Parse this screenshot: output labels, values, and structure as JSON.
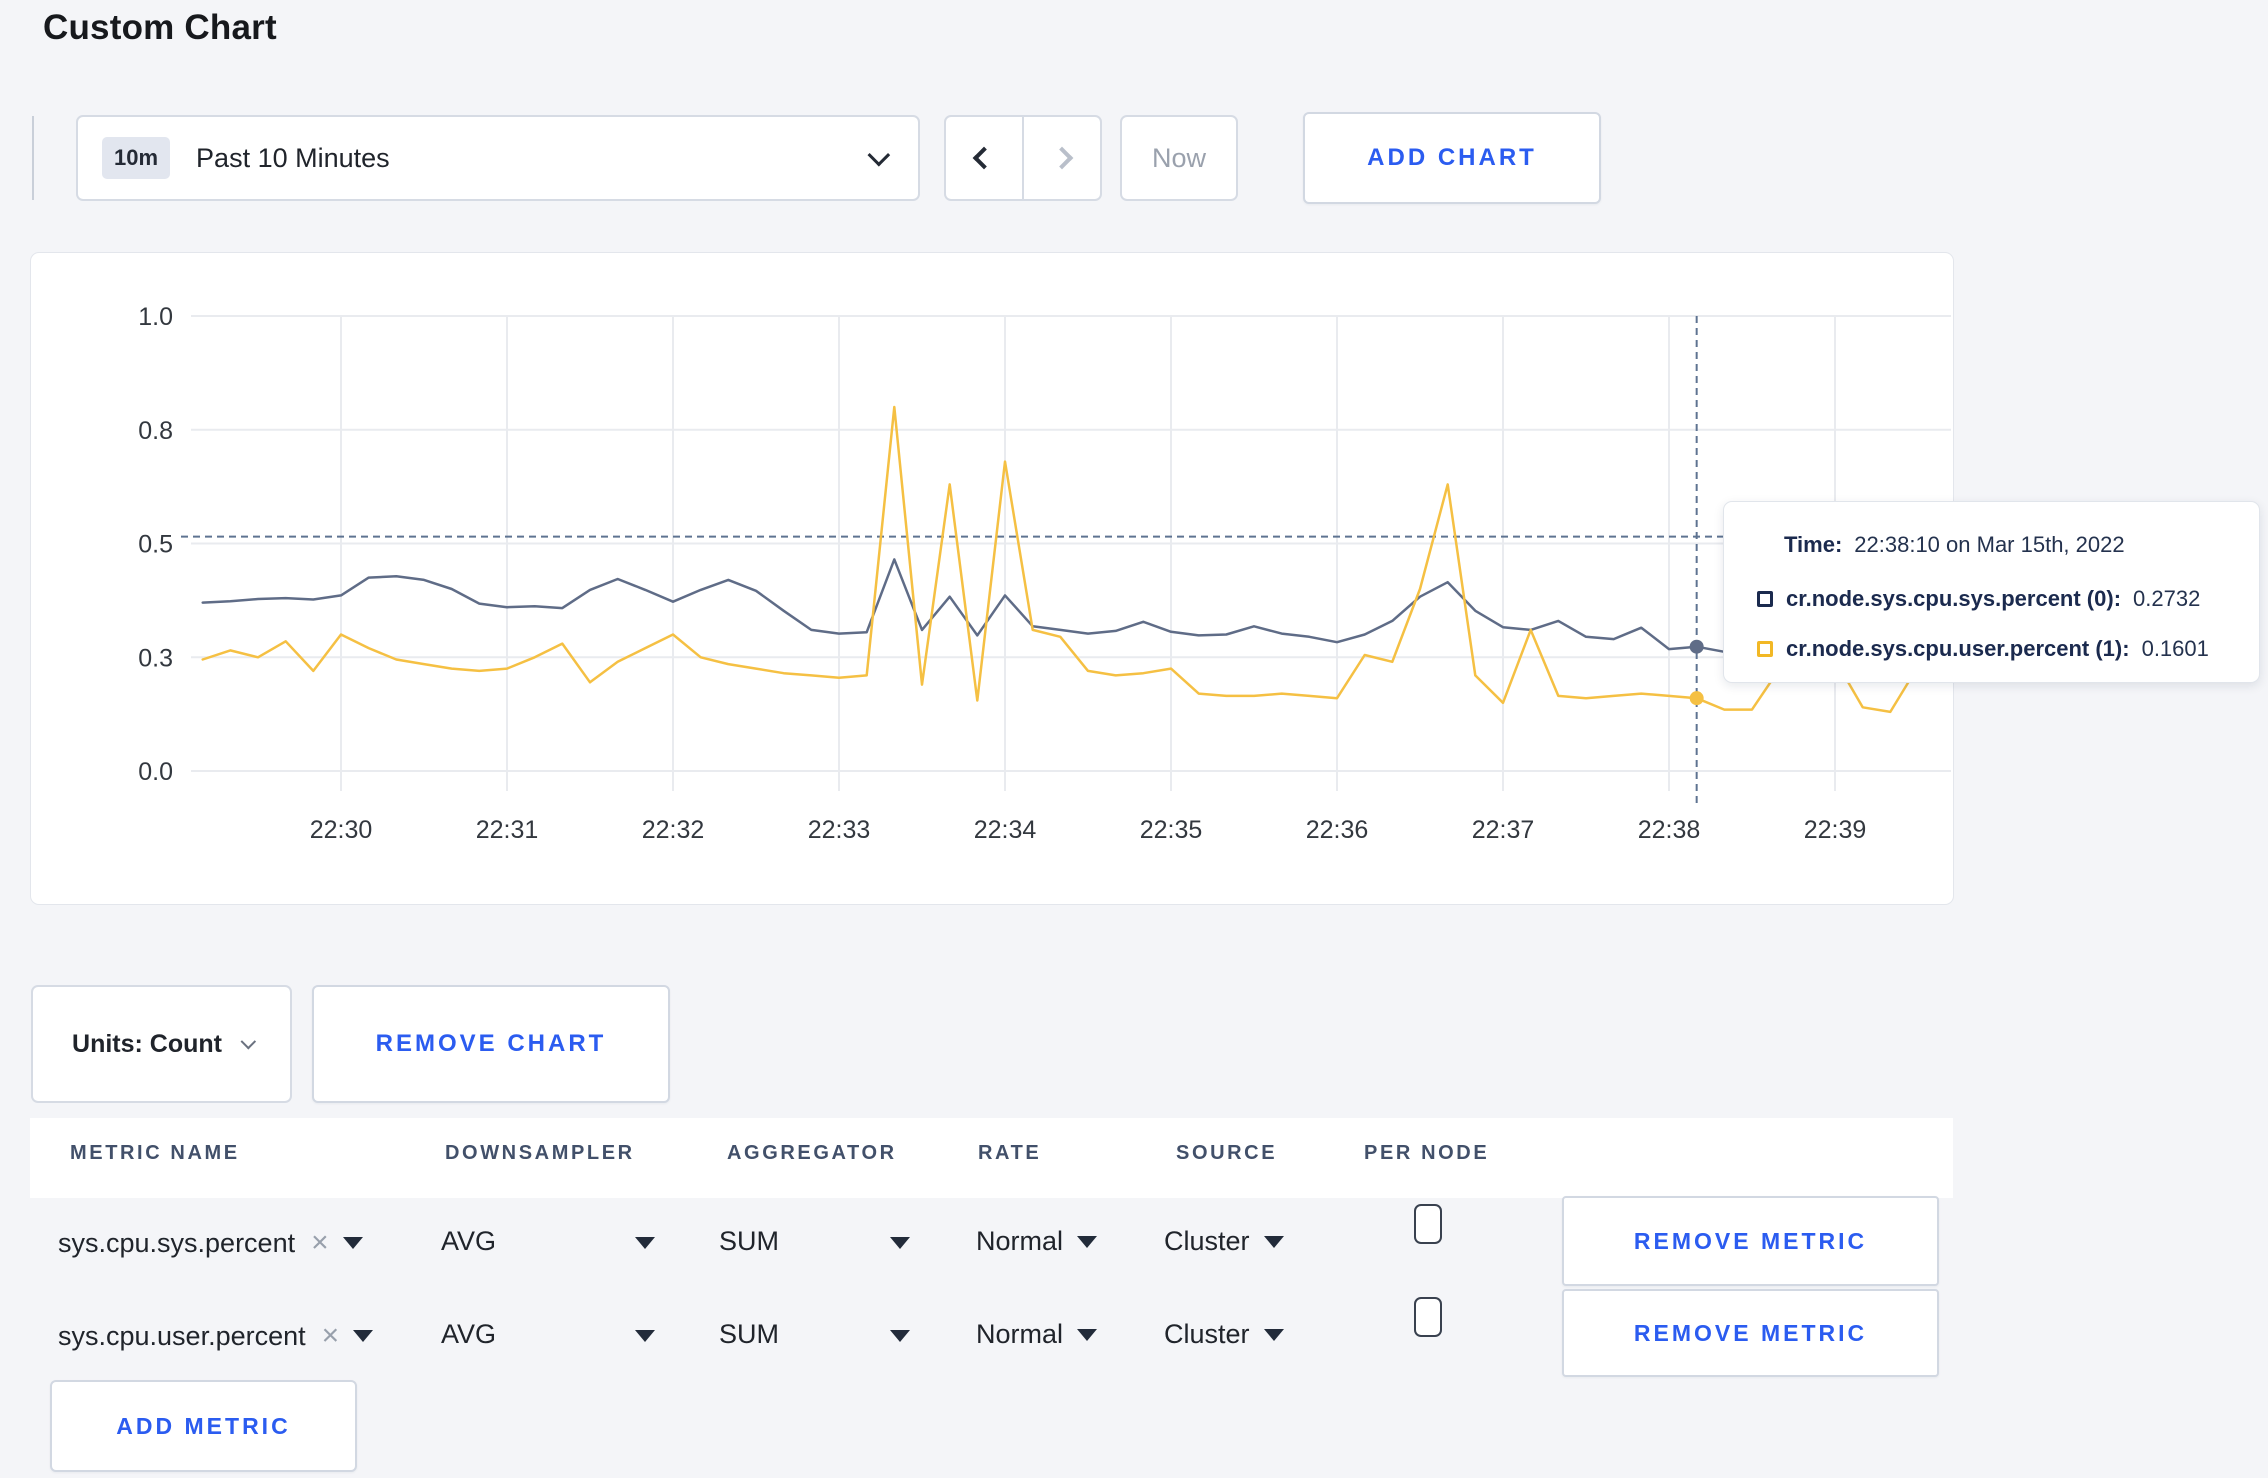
{
  "page": {
    "title": "Custom Chart"
  },
  "toolbar": {
    "range_badge": "10m",
    "range_label": "Past 10 Minutes",
    "now_label": "Now",
    "add_chart_label": "ADD CHART"
  },
  "chart_data": {
    "type": "line",
    "title": "",
    "x_start": "22:29:10",
    "x_interval_seconds": 10,
    "x_tick_labels": [
      "22:30",
      "22:31",
      "22:32",
      "22:33",
      "22:34",
      "22:35",
      "22:36",
      "22:37",
      "22:38",
      "22:39"
    ],
    "y_tick_labels": [
      "1.0",
      "0.8",
      "0.5",
      "0.3",
      "0.0"
    ],
    "ylim": [
      0,
      1
    ],
    "grid": true,
    "series": [
      {
        "name": "cr.node.sys.cpu.sys.percent",
        "color": "#5f6c87",
        "values": [
          0.37,
          0.373,
          0.378,
          0.38,
          0.377,
          0.386,
          0.425,
          0.428,
          0.42,
          0.4,
          0.368,
          0.36,
          0.362,
          0.358,
          0.398,
          0.422,
          0.398,
          0.372,
          0.398,
          0.42,
          0.396,
          0.352,
          0.31,
          0.302,
          0.305,
          0.465,
          0.31,
          0.383,
          0.298,
          0.386,
          0.318,
          0.31,
          0.302,
          0.308,
          0.328,
          0.306,
          0.298,
          0.3,
          0.318,
          0.302,
          0.295,
          0.283,
          0.3,
          0.33,
          0.383,
          0.415,
          0.352,
          0.316,
          0.31,
          0.33,
          0.295,
          0.29,
          0.315,
          0.268,
          0.2732,
          0.262,
          0.27,
          0.285,
          0.29,
          0.285,
          0.29,
          0.295,
          0.3,
          0.3
        ]
      },
      {
        "name": "cr.node.sys.cpu.user.percent",
        "color": "#f5c043",
        "values": [
          0.245,
          0.265,
          0.25,
          0.285,
          0.22,
          0.3,
          0.27,
          0.245,
          0.235,
          0.225,
          0.22,
          0.225,
          0.25,
          0.28,
          0.195,
          0.24,
          0.27,
          0.3,
          0.25,
          0.235,
          0.225,
          0.215,
          0.21,
          0.205,
          0.21,
          0.8,
          0.19,
          0.63,
          0.155,
          0.68,
          0.31,
          0.295,
          0.22,
          0.21,
          0.215,
          0.225,
          0.17,
          0.165,
          0.165,
          0.17,
          0.165,
          0.16,
          0.255,
          0.24,
          0.4,
          0.63,
          0.21,
          0.15,
          0.31,
          0.165,
          0.16,
          0.165,
          0.17,
          0.165,
          0.1601,
          0.135,
          0.135,
          0.225,
          0.23,
          0.245,
          0.14,
          0.13,
          0.23,
          0.27
        ]
      }
    ],
    "crosshair": {
      "x_index": 54,
      "time": "22:38:10",
      "y_value": 0.515
    }
  },
  "tooltip": {
    "time_label": "Time:",
    "time_value": "22:38:10 on Mar 15th, 2022",
    "rows": [
      {
        "name": "cr.node.sys.cpu.sys.percent (0):",
        "value": "0.2732",
        "color": "#1b2a4e"
      },
      {
        "name": "cr.node.sys.cpu.user.percent (1):",
        "value": "0.1601",
        "color": "#f2b825"
      }
    ]
  },
  "chart_footer": {
    "units_label": "Units: Count",
    "remove_chart_label": "REMOVE CHART"
  },
  "metrics_table": {
    "headers": [
      "METRIC NAME",
      "DOWNSAMPLER",
      "AGGREGATOR",
      "RATE",
      "SOURCE",
      "PER NODE"
    ],
    "rows": [
      {
        "metric": "sys.cpu.sys.percent",
        "remove_icon": "×",
        "downsampler": "AVG",
        "aggregator": "SUM",
        "rate": "Normal",
        "source": "Cluster",
        "per_node_checked": false,
        "remove_label": "REMOVE METRIC"
      },
      {
        "metric": "sys.cpu.user.percent",
        "remove_icon": "×",
        "downsampler": "AVG",
        "aggregator": "SUM",
        "rate": "Normal",
        "source": "Cluster",
        "per_node_checked": false,
        "remove_label": "REMOVE METRIC"
      }
    ],
    "add_metric_label": "ADD METRIC"
  },
  "colors": {
    "accent_blue": "#2b5cf0",
    "page_bg": "#f4f5f8",
    "gridline": "#e9ebef",
    "crosshair": "#5e7391",
    "axis_text": "#33383f"
  }
}
